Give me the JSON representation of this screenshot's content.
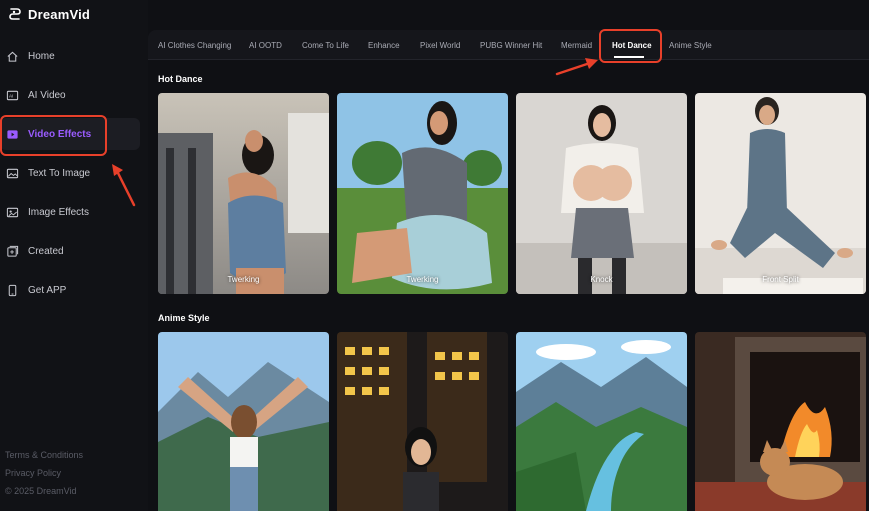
{
  "brand": {
    "name": "DreamVid"
  },
  "sidebar": {
    "items": [
      {
        "label": "Home",
        "icon": "home-icon"
      },
      {
        "label": "AI Video",
        "icon": "ai-video-icon"
      },
      {
        "label": "Video Effects",
        "icon": "video-effects-icon",
        "active": true
      },
      {
        "label": "Text To Image",
        "icon": "image-icon"
      },
      {
        "label": "Image Effects",
        "icon": "image-effects-icon"
      },
      {
        "label": "Created",
        "icon": "created-icon"
      },
      {
        "label": "Get APP",
        "icon": "phone-icon"
      }
    ],
    "footer": {
      "terms": "Terms & Conditions",
      "privacy": "Privacy Policy",
      "copyright": "© 2025 DreamVid"
    }
  },
  "tabs": [
    {
      "label": "AI Clothes Changing"
    },
    {
      "label": "AI OOTD"
    },
    {
      "label": "Come To Life"
    },
    {
      "label": "Enhance"
    },
    {
      "label": "Pixel World"
    },
    {
      "label": "PUBG Winner Hit"
    },
    {
      "label": "Mermaid"
    },
    {
      "label": "Hot Dance",
      "active": true
    },
    {
      "label": "Anime Style"
    }
  ],
  "sections": {
    "hot_dance": {
      "title": "Hot Dance",
      "cards": [
        {
          "label": "Twerking"
        },
        {
          "label": "Twerking"
        },
        {
          "label": "Knock"
        },
        {
          "label": "Front Split"
        }
      ]
    },
    "anime_style": {
      "title": "Anime Style",
      "cards": [
        {
          "label": ""
        },
        {
          "label": ""
        },
        {
          "label": ""
        },
        {
          "label": ""
        }
      ]
    }
  },
  "colors": {
    "accent": "#9a5cff",
    "highlight": "#e8402a",
    "background": "#0f1014"
  }
}
